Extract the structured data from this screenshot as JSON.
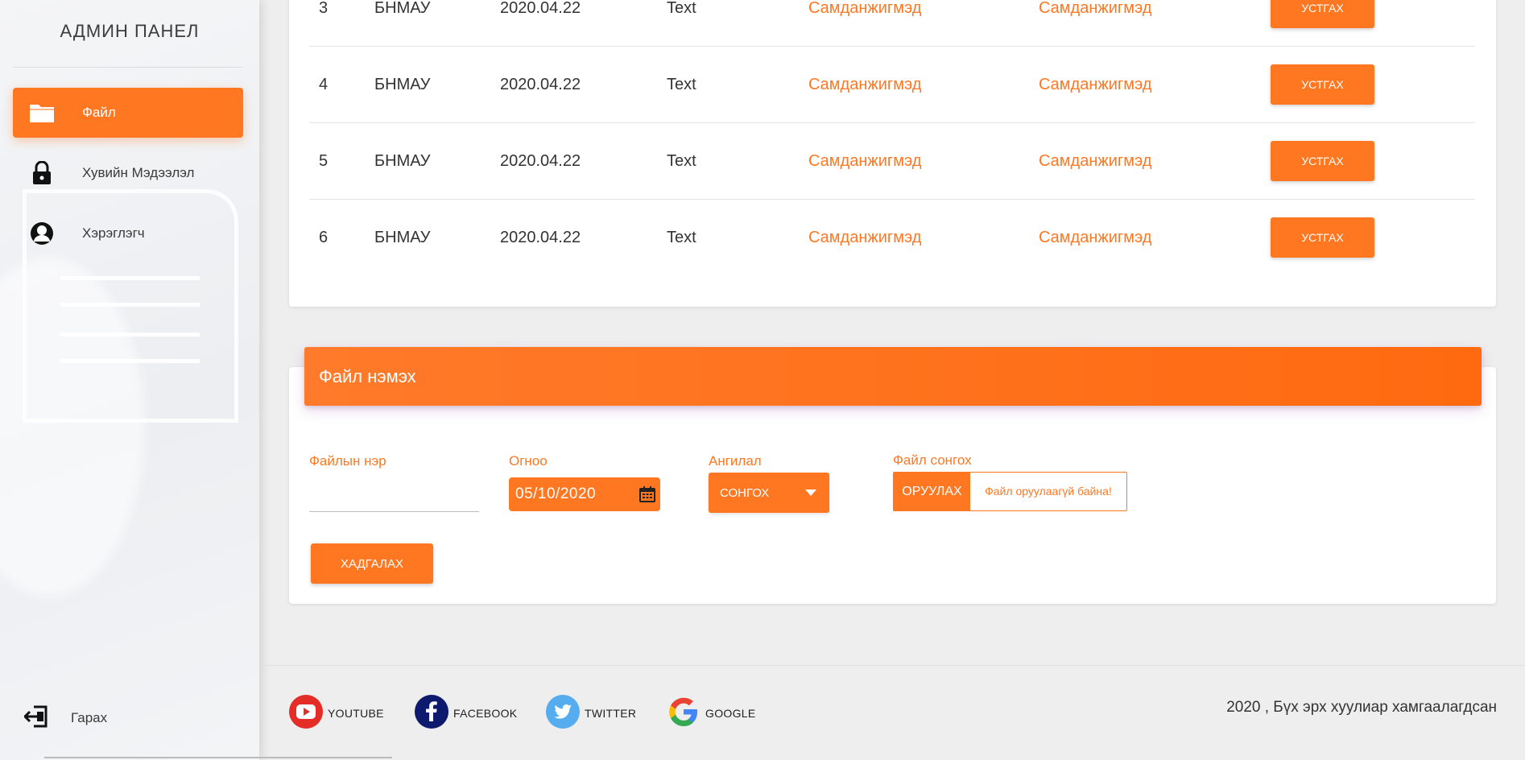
{
  "sidebar": {
    "brand": "АДМИН ПАНЕЛ",
    "items": [
      {
        "label": "Файл",
        "icon": "folder-icon",
        "active": true
      },
      {
        "label": "Хувийн Мэдээлэл",
        "icon": "lock-icon",
        "active": false
      },
      {
        "label": "Хэрэглэгч",
        "icon": "user-icon",
        "active": false
      }
    ],
    "logout_label": "Гарах"
  },
  "table": {
    "rows": [
      {
        "no": "3",
        "name": "БНМАУ",
        "date": "2020.04.22",
        "type": "Text",
        "col5": "Самданжигмэд",
        "col6": "Самданжигмэд",
        "action": "УСТГАХ"
      },
      {
        "no": "4",
        "name": "БНМАУ",
        "date": "2020.04.22",
        "type": "Text",
        "col5": "Самданжигмэд",
        "col6": "Самданжигмэд",
        "action": "УСТГАХ"
      },
      {
        "no": "5",
        "name": "БНМАУ",
        "date": "2020.04.22",
        "type": "Text",
        "col5": "Самданжигмэд",
        "col6": "Самданжигмэд",
        "action": "УСТГАХ"
      },
      {
        "no": "6",
        "name": "БНМАУ",
        "date": "2020.04.22",
        "type": "Text",
        "col5": "Самданжигмэд",
        "col6": "Самданжигмэд",
        "action": "УСТГАХ"
      }
    ]
  },
  "add_file": {
    "title": "Файл нэмэх",
    "name_label": "Файлын нэр",
    "name_value": "",
    "date_label": "Огноо",
    "date_value": "05/10/2020",
    "category_label": "Ангилал",
    "category_value": "СОНГОХ",
    "file_label": "Файл сонгох",
    "upload_button": "ОРУУЛАХ",
    "upload_status": "Файл оруулаагүй байна!",
    "save_button": "ХАДГАЛАХ"
  },
  "footer": {
    "social": [
      {
        "label": "YOUTUBE",
        "icon": "youtube-icon"
      },
      {
        "label": "FACEBOOK",
        "icon": "facebook-icon"
      },
      {
        "label": "TWITTER",
        "icon": "twitter-icon"
      },
      {
        "label": "GOOGLE",
        "icon": "google-icon"
      }
    ],
    "copyright": "2020 , Бүх эрх хуулиар хамгаалагдсан"
  },
  "colors": {
    "accent": "#ff7721",
    "background": "#eeeeee",
    "card": "#ffffff"
  }
}
